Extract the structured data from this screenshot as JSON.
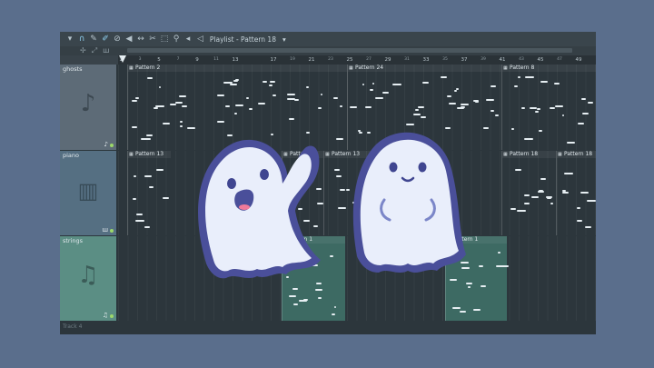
{
  "toolbar": {
    "icons": [
      "chevron-down-icon",
      "magnet-icon",
      "pencil-icon",
      "brush-icon",
      "delete-icon",
      "mute-icon",
      "slip-icon",
      "slice-icon",
      "select-icon",
      "zoom-icon",
      "speaker-icon"
    ],
    "title": "Playlist - Pattern 18"
  },
  "ruler": {
    "ticks": [
      "1",
      "5",
      "9",
      "13",
      "17",
      "21",
      "25",
      "29",
      "33",
      "37",
      "41",
      "45",
      "49"
    ],
    "minor_ticks": [
      "3",
      "7",
      "11",
      "19",
      "23",
      "27",
      "31",
      "35",
      "39",
      "43",
      "47"
    ]
  },
  "tracks": [
    {
      "name": "ghosts",
      "icon": "music-note-icon",
      "clips": [
        {
          "label": "Pattern 2"
        },
        {
          "label": "Pattern 24"
        },
        {
          "label": "Pattern 8"
        }
      ]
    },
    {
      "name": "piano",
      "icon": "piano-keys-icon",
      "clips": [
        {
          "label": "Pattern 13"
        },
        {
          "label": "Pattern 13"
        },
        {
          "label": "Pattern 13"
        },
        {
          "label": "Pattern 18"
        },
        {
          "label": "Pattern 18"
        }
      ]
    },
    {
      "name": "strings",
      "icon": "violin-icon",
      "clips": [
        {
          "label": "Pat..rn 1"
        },
        {
          "label": "Pattern 1"
        }
      ]
    }
  ],
  "footer": {
    "track_name": "Track 4"
  },
  "colors": {
    "ghosts_header": "#5d6b77",
    "piano_header": "#556f82",
    "strings_header": "#5b8e84",
    "strings_clip": "#3d6a63",
    "ghost_body": "#e9eefb",
    "ghost_outline": "#4a4f9a"
  }
}
